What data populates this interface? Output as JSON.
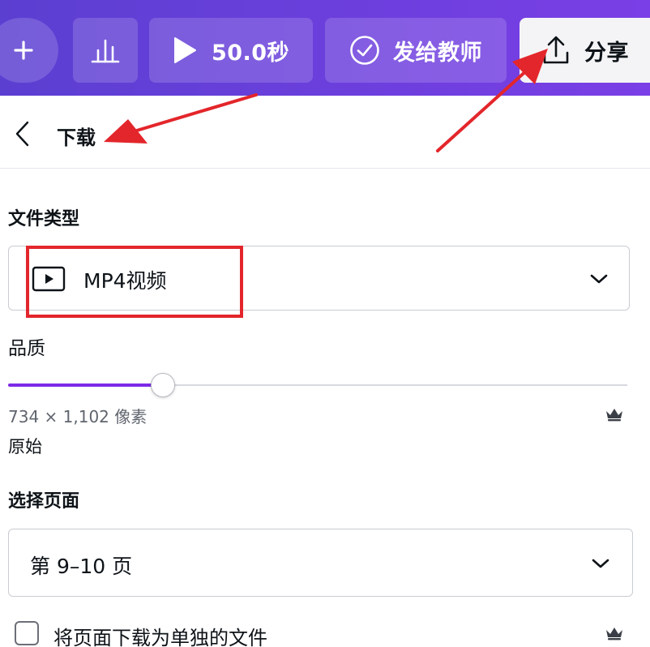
{
  "toolbar": {
    "add_icon": "plus-icon",
    "chart_icon": "bar-chart-icon",
    "play_icon": "play-icon",
    "duration": "50.0秒",
    "send_icon": "check-circle-icon",
    "send_label": "发给教师",
    "share_icon": "upload-icon",
    "share_label": "分享",
    "gradient_start": "#5b3fd1",
    "gradient_end": "#7a3fe6"
  },
  "header": {
    "back_icon": "chevron-left-icon",
    "title": "下载"
  },
  "file_type": {
    "label": "文件类型",
    "icon": "video-file-icon",
    "value": "MP4视频"
  },
  "quality": {
    "label": "品质",
    "level": 0.25,
    "accent": "#7d2ae8",
    "dimensions": "734 × 1,102 像素",
    "name": "原始",
    "premium_icon": "crown-icon"
  },
  "pages": {
    "label": "选择页面",
    "value": "第 9–10 页"
  },
  "separate_files": {
    "label": "将页面下载为单独的文件",
    "checked": false,
    "premium_icon": "crown-icon"
  },
  "annotations": {
    "color": "#e3262b"
  }
}
